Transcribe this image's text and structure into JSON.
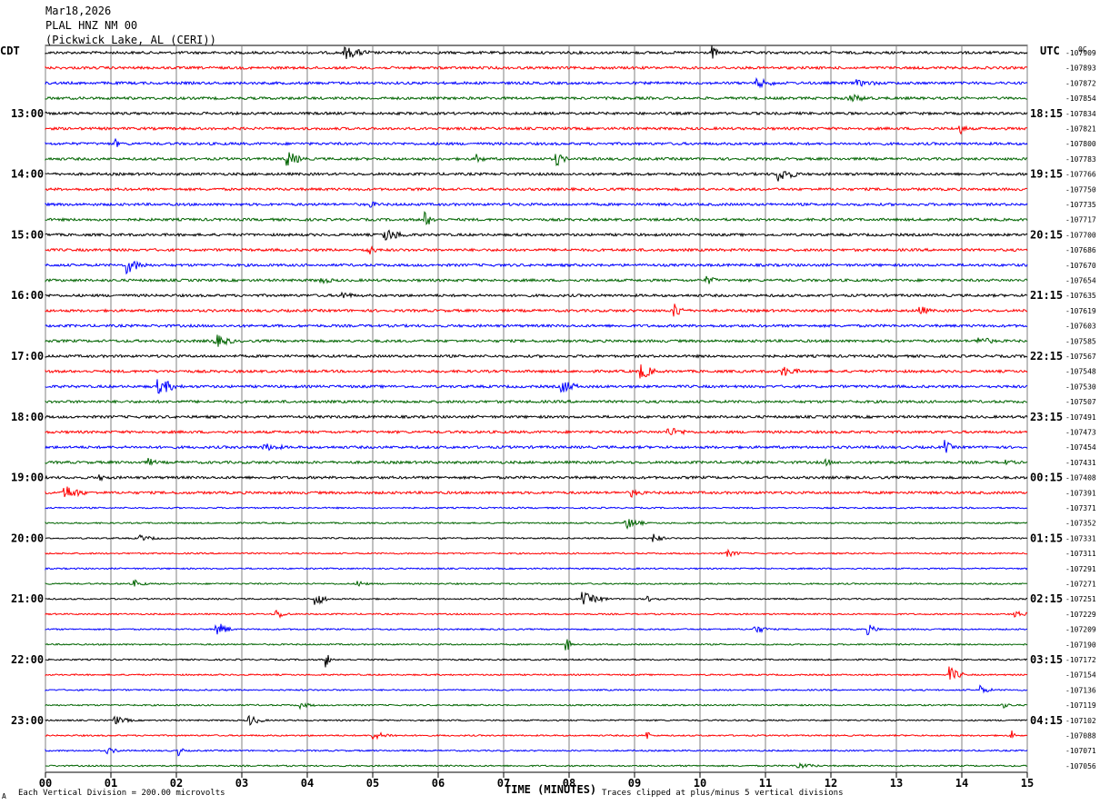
{
  "header": {
    "date": "Mar18,2026",
    "station": "PLAL HNZ NM 00",
    "location": "(Pickwick Lake, AL (CERI))"
  },
  "left_tz": "CDT",
  "right_tz": "UTC",
  "right_corner": "0C",
  "colors": [
    "#000000",
    "#ff0000",
    "#0000ff",
    "#006400"
  ],
  "grid_color": "#808080",
  "chart_data": {
    "type": "line",
    "subtype": "helicorder",
    "xlabel": "TIME (MINUTES)",
    "x_ticks": [
      "00",
      "01",
      "02",
      "03",
      "04",
      "05",
      "06",
      "07",
      "08",
      "09",
      "10",
      "11",
      "12",
      "13",
      "14",
      "15"
    ],
    "xlim": [
      0,
      15
    ],
    "traces_per_hour": 4,
    "left_hour_labels": [
      "",
      "13:00",
      "14:00",
      "15:00",
      "16:00",
      "17:00",
      "18:00",
      "19:00",
      "20:00",
      "21:00",
      "22:00",
      "23:00"
    ],
    "right_hour_labels": [
      "",
      "18:15",
      "19:15",
      "20:15",
      "21:15",
      "22:15",
      "23:15",
      "00:15",
      "01:15",
      "02:15",
      "03:15",
      "04:15"
    ],
    "trace_offsets": [
      "-107909",
      "-107893",
      "-107872",
      "-107854",
      "-107834",
      "-107821",
      "-107800",
      "-107783",
      "-107766",
      "-107750",
      "-107735",
      "-107717",
      "-107700",
      "-107686",
      "-107670",
      "-107654",
      "-107635",
      "-107619",
      "-107603",
      "-107585",
      "-107567",
      "-107548",
      "-107530",
      "-107507",
      "-107491",
      "-107473",
      "-107454",
      "-107431",
      "-107408",
      "-107391",
      "-107371",
      "-107352",
      "-107331",
      "-107311",
      "-107291",
      "-107271",
      "-107251",
      "-107229",
      "-107209",
      "-107190",
      "-107172",
      "-107154",
      "-107136",
      "-107119",
      "-107102",
      "-107088",
      "-107071",
      "-107056"
    ],
    "grid": true
  },
  "footer": {
    "scale": "Each Vertical Division =  200.00 microvolts",
    "clip_note": "Traces clipped at plus/minus 5 vertical divisions",
    "corner_mark": "A"
  }
}
